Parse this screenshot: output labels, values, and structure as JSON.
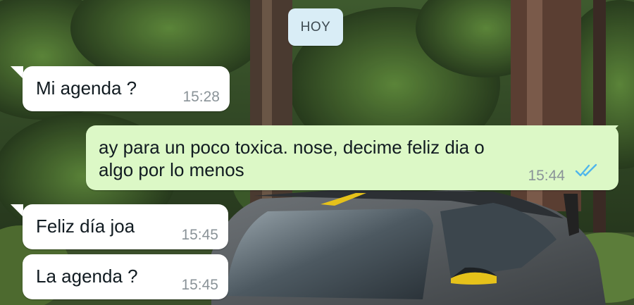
{
  "date_chip": "HOY",
  "messages": [
    {
      "direction": "incoming",
      "text": "Mi agenda ?",
      "time": "15:28"
    },
    {
      "direction": "outgoing",
      "text_line1": "ay para un poco toxica. nose, decime feliz dia o",
      "text_line2": "algo por lo menos",
      "time": "15:44",
      "status": "read"
    },
    {
      "direction": "incoming",
      "text": "Feliz día joa",
      "time": "15:45"
    },
    {
      "direction": "incoming",
      "text": "La agenda ?",
      "time": "15:45"
    }
  ],
  "colors": {
    "incoming_bubble": "#ffffff",
    "outgoing_bubble": "#dcf8c6",
    "date_chip": "#d9edf6",
    "read_ticks": "#4fb6ec",
    "timestamp": "#8a9398"
  },
  "wallpaper": "forest-with-grey-car",
  "icons": {
    "read_receipt": "double-check-icon"
  }
}
